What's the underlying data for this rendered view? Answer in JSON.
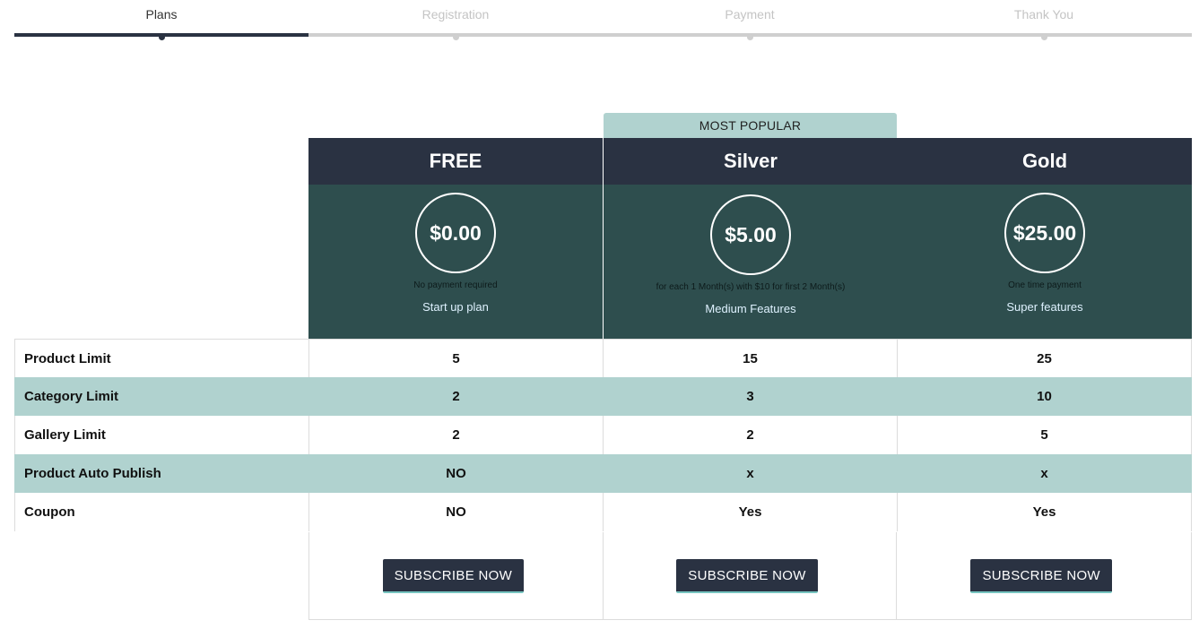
{
  "steps": [
    {
      "label": "Plans",
      "active": true
    },
    {
      "label": "Registration",
      "active": false
    },
    {
      "label": "Payment",
      "active": false
    },
    {
      "label": "Thank You",
      "active": false
    }
  ],
  "popular_badge": "MOST POPULAR",
  "plans": [
    {
      "name": "FREE",
      "price": "$0.00",
      "note": "No payment required",
      "description": "Start up plan",
      "button": "SUBSCRIBE NOW"
    },
    {
      "name": "Silver",
      "price": "$5.00",
      "note": "for each 1 Month(s) with $10 for first 2 Month(s)",
      "description": "Medium Features",
      "button": "SUBSCRIBE NOW"
    },
    {
      "name": "Gold",
      "price": "$25.00",
      "note": "One time payment",
      "description": "Super features",
      "button": "SUBSCRIBE NOW"
    }
  ],
  "features": [
    {
      "name": "Product Limit",
      "values": [
        "5",
        "15",
        "25"
      ]
    },
    {
      "name": "Category Limit",
      "values": [
        "2",
        "3",
        "10"
      ]
    },
    {
      "name": "Gallery Limit",
      "values": [
        "2",
        "2",
        "5"
      ]
    },
    {
      "name": "Product Auto Publish",
      "values": [
        "NO",
        "x",
        "x"
      ]
    },
    {
      "name": "Coupon",
      "values": [
        "NO",
        "Yes",
        "Yes"
      ]
    }
  ],
  "colors": {
    "header_dark": "#2a3242",
    "price_band": "#2e4e4e",
    "accent_teal": "#b0d2cf"
  }
}
